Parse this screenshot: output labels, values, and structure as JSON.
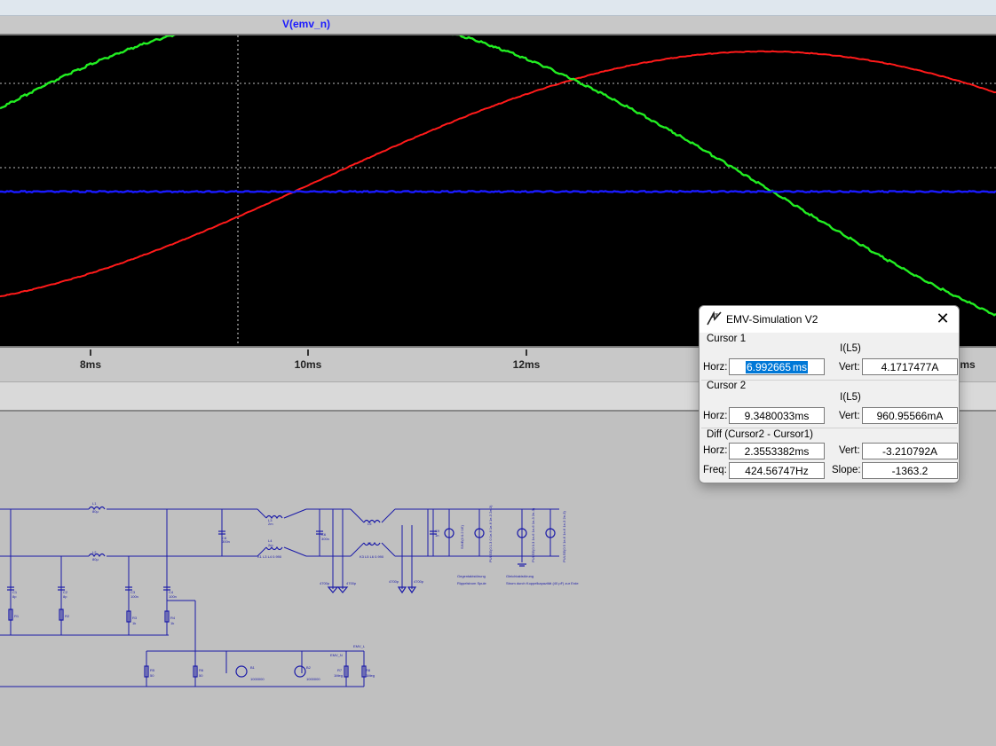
{
  "plot": {
    "title": "V(emv_n)",
    "xticks": [
      {
        "label": "8ms",
        "x": 8
      },
      {
        "label": "10ms",
        "x": 10
      },
      {
        "label": "12ms",
        "x": 12
      },
      {
        "label": "ms",
        "x": 16
      }
    ],
    "colors": {
      "red": "#ff1a1a",
      "green": "#22ee22",
      "blue": "#1a1aff",
      "grid": "#bbbbbb"
    }
  },
  "dialog": {
    "title": "EMV-Simulation V2",
    "close_label": "✕",
    "cursor1": {
      "label": "Cursor 1",
      "trace": "I(L5)",
      "horz_label": "Horz:",
      "horz_value_selected": "6.992665",
      "horz_value_rest": "ms",
      "vert_label": "Vert:",
      "vert_value": "4.1717477A"
    },
    "cursor2": {
      "label": "Cursor 2",
      "trace": "I(L5)",
      "horz_label": "Horz:",
      "horz_value": "9.3480033ms",
      "vert_label": "Vert:",
      "vert_value": "960.95566mA"
    },
    "diff": {
      "label": "Diff (Cursor2 - Cursor1)",
      "horz_label": "Horz:",
      "horz_value": "2.3553382ms",
      "vert_label": "Vert:",
      "vert_value": "-3.210792A",
      "freq_label": "Freq:",
      "freq_value": "424.56747Hz",
      "slope_label": "Slope:",
      "slope_value": "-1363.2"
    }
  }
}
